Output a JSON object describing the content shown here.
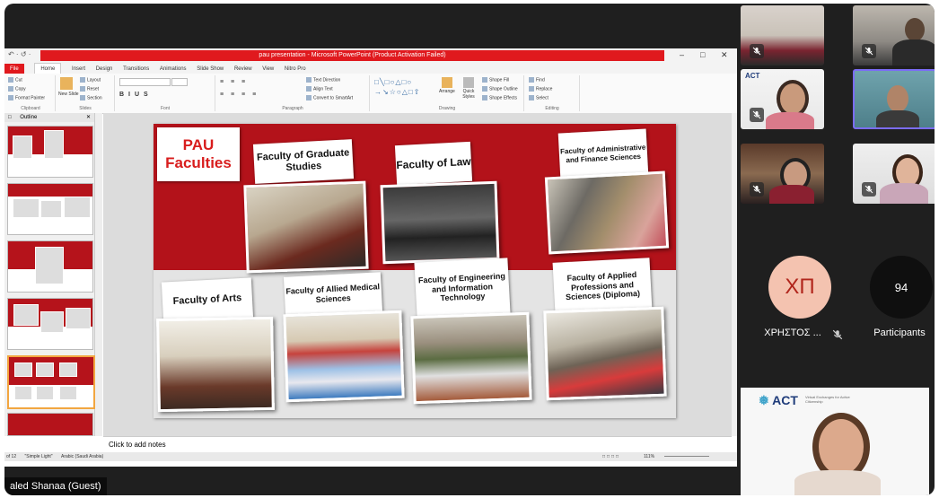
{
  "ppt": {
    "title_text": "pau presentation - Microsoft PowerPoint (Product Activation Failed)",
    "quick_access": "↶ · ↺ ·",
    "tabs": [
      "File",
      "Home",
      "Insert",
      "Design",
      "Transitions",
      "Animations",
      "Slide Show",
      "Review",
      "View",
      "Nitro Pro"
    ],
    "clipboard": {
      "cut": "Cut",
      "copy": "Copy",
      "painter": "Format Painter",
      "label": "Clipboard"
    },
    "slides_grp": {
      "new": "New Slide",
      "layout": "Layout",
      "reset": "Reset",
      "section": "Section",
      "label": "Slides"
    },
    "font_label": "Font",
    "paragraph": {
      "direction": "Text Direction",
      "align": "Align Text",
      "smartart": "Convert to SmartArt",
      "label": "Paragraph"
    },
    "drawing": {
      "arrange": "Arrange",
      "quick": "Quick Styles",
      "fill": "Shape Fill",
      "outline": "Shape Outline",
      "effects": "Shape Effects",
      "label": "Drawing"
    },
    "editing": {
      "find": "Find",
      "replace": "Replace",
      "select": "Select",
      "label": "Editing"
    },
    "outline_tab": "Outline",
    "notes_placeholder": "Click to add notes",
    "status": {
      "slide": "of 12",
      "theme": "\"Simple Light\"",
      "lang": "Arabic (Saudi Arabia)",
      "zoom": "111%"
    }
  },
  "slide": {
    "main_title": "PAU Faculties",
    "faculties": [
      "Faculty of Graduate Studies",
      "Faculty of Law",
      "Faculty of Administrative and Finance Sciences",
      "Faculty of Arts",
      "Faculty of Allied Medical Sciences",
      "Faculty of Engineering and Information Technology",
      "Faculty of Applied Professions and Sciences (Diploma)"
    ]
  },
  "guest_name": "aled Shanaa (Guest)",
  "participants": {
    "user_initials": "ΧΠ",
    "user_name": "ΧΡΗΣΤΟΣ ...",
    "count": "94",
    "count_label": "Participants"
  },
  "act_logo": {
    "name": "ACT",
    "tagline": "Virtual Exchanges for Active Citizenship"
  },
  "colors": {
    "ppt_red": "#e0191e",
    "slide_red": "#b3121a",
    "avatar": "#f4c3b0",
    "avatar_text": "#b1261c",
    "bg": "#1f1f1f"
  }
}
